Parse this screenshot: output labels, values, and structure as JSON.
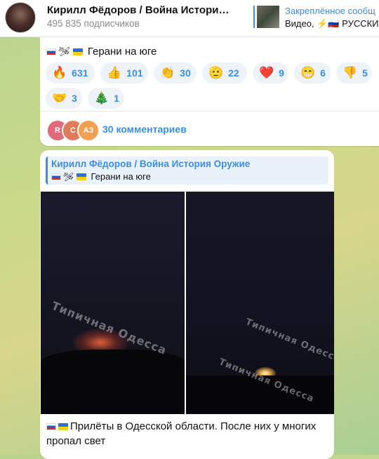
{
  "header": {
    "title": "Кирилл Фёдоров / Война Истори…",
    "subscribers": "495 835 подписчиков",
    "pinned_title": "Закреплённое сообщ",
    "pinned_text": "Видео, ⚡🇷🇺 РУССКИ"
  },
  "post1": {
    "text_emoji": "🇷🇺 🛩 🇺🇦",
    "text": "Герани на юге",
    "reactions": [
      {
        "emoji": "🔥",
        "count": "631"
      },
      {
        "emoji": "👍",
        "count": "101"
      },
      {
        "emoji": "👏",
        "count": "30"
      },
      {
        "emoji": "🫡",
        "count": "22"
      },
      {
        "emoji": "❤️",
        "count": "9"
      },
      {
        "emoji": "😁",
        "count": "6"
      },
      {
        "emoji": "👎",
        "count": "5"
      },
      {
        "emoji": "🤝",
        "count": "3"
      },
      {
        "emoji": "🎄",
        "count": "1"
      }
    ],
    "commenter_initials": [
      "R",
      "C",
      "АЗ"
    ],
    "commenter_colors": [
      "#e06a7a",
      "#e07a5a",
      "#f0a050"
    ],
    "comments": "30 комментариев"
  },
  "post2": {
    "reply_author": "Кирилл Фёдоров / Война История Оружие",
    "reply_emoji": "🇷🇺 🛩 🇺🇦",
    "reply_text": "Герани на юге",
    "watermark": "Типичная Одесса",
    "caption": "Прилёты в Одесской области. После них у многих пропал свет"
  }
}
